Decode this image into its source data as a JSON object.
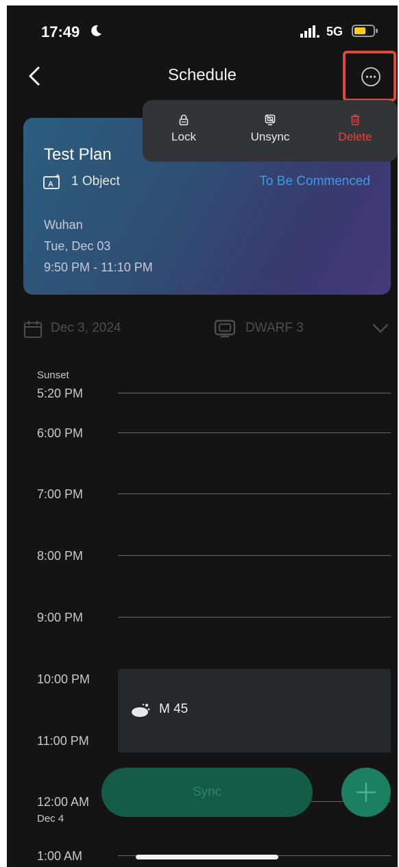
{
  "status_bar": {
    "time": "17:49",
    "network": "5G",
    "battery_level": 0.5,
    "battery_color": "#f4cf1c"
  },
  "nav": {
    "title": "Schedule",
    "back_icon": "chevron-left-icon",
    "more_icon": "more-horizontal-icon",
    "highlight_color": "#e2493b"
  },
  "plan": {
    "title": "Test Plan",
    "object_count": "1 Object",
    "status": "To Be Commenced",
    "location": "Wuhan",
    "date": "Tue, Dec 03",
    "time_range": "9:50 PM - 11:10 PM"
  },
  "menu": {
    "items": [
      {
        "label": "Lock",
        "icon": "lock-icon"
      },
      {
        "label": "Unsync",
        "icon": "unsync-icon"
      },
      {
        "label": "Delete",
        "icon": "trash-icon",
        "color": "#e5413a"
      }
    ]
  },
  "filter": {
    "date": "Dec 3, 2024",
    "device": "DWARF 3"
  },
  "timeline": {
    "sunset_label": "Sunset",
    "sunset_time": "5:20 PM",
    "hours": [
      "6:00 PM",
      "7:00 PM",
      "8:00 PM",
      "9:00 PM",
      "10:00 PM",
      "11:00 PM",
      "12:00 AM",
      "1:00 AM"
    ],
    "next_day_label": "Dec 4"
  },
  "event": {
    "name": "M 45",
    "icon": "star-cluster-icon"
  },
  "actions": {
    "sync_label": "Sync",
    "add_icon": "plus-icon"
  }
}
